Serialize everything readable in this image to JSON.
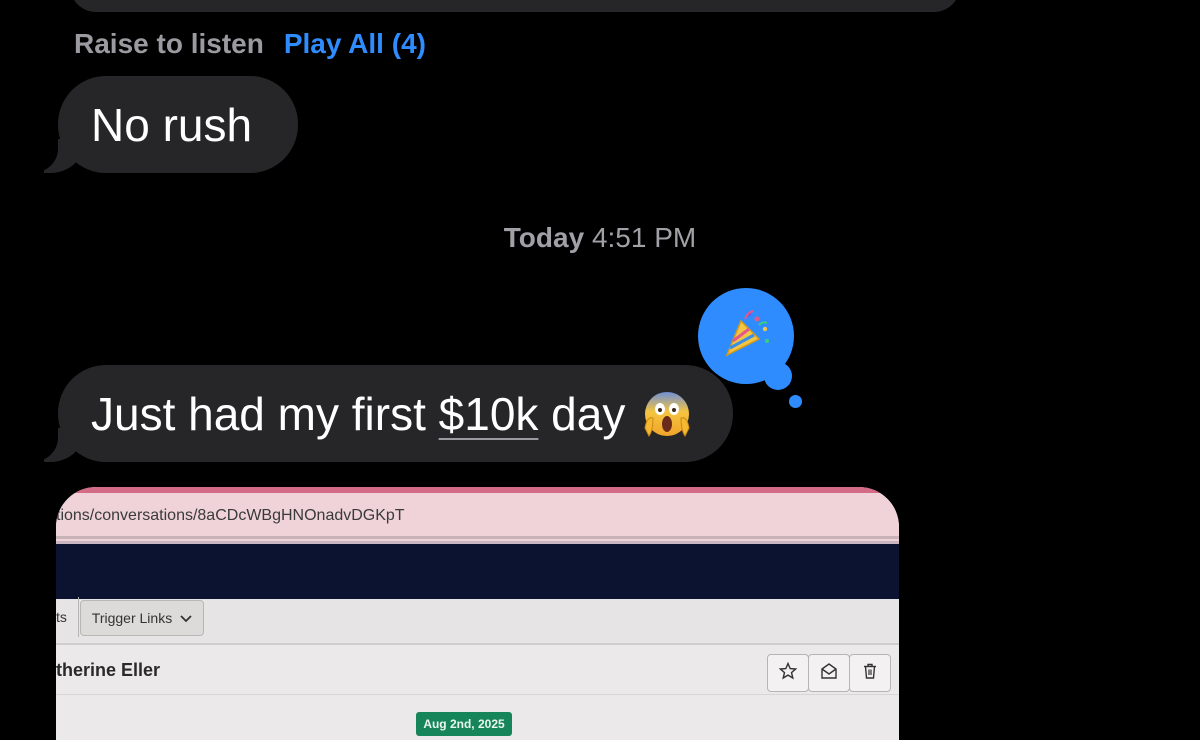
{
  "audio_message": {
    "raise_label": "Raise to listen",
    "play_all_label": "Play All (4)"
  },
  "messages": [
    {
      "text": "No rush"
    },
    {
      "text_before": "Just had my first ",
      "link_text": "$10k",
      "text_after": " day",
      "emoji": "face-screaming-in-fear"
    }
  ],
  "timestamp": {
    "day": "Today",
    "time": "4:51 PM"
  },
  "tapback": {
    "emoji": "party-popper",
    "color": "#2f8cff"
  },
  "photo": {
    "url_text": "tions/conversations/8aCDcWBgHNOnadvDGKpT",
    "tab_fragment": "ts",
    "trigger_label": "Trigger Links",
    "contact_name": "therine Eller",
    "date_pill": "Aug 2nd, 2025",
    "action_icons": [
      "star-icon",
      "mail-open-icon",
      "trash-icon"
    ]
  },
  "colors": {
    "background": "#000000",
    "bubble": "#262629",
    "accent_blue": "#2f8cff",
    "muted_text": "#9a9aa0"
  }
}
